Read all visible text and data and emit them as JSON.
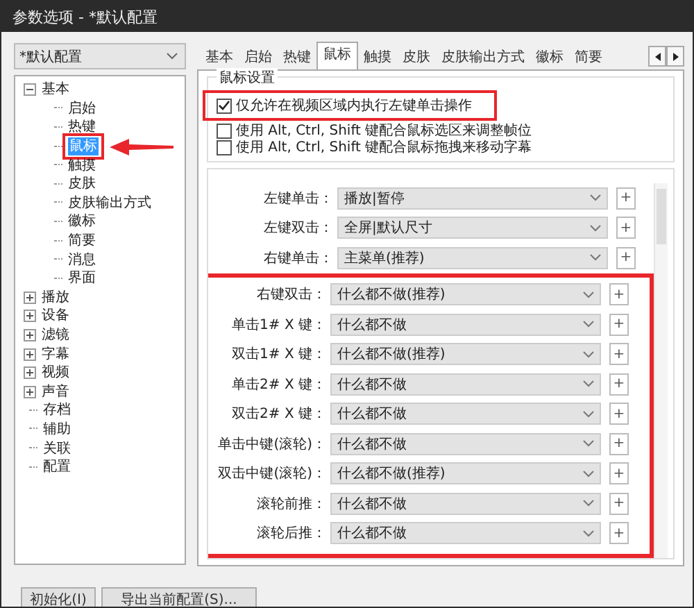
{
  "window": {
    "title": "参数选项 - *默认配置"
  },
  "profile_select": {
    "value": "*默认配置"
  },
  "tree": [
    {
      "label": "基本",
      "expanded": true,
      "selected": false,
      "children": [
        {
          "label": "启始",
          "selected": false
        },
        {
          "label": "热键",
          "selected": false
        },
        {
          "label": "鼠标",
          "selected": true
        },
        {
          "label": "触摸",
          "selected": false
        },
        {
          "label": "皮肤",
          "selected": false
        },
        {
          "label": "皮肤输出方式",
          "selected": false
        },
        {
          "label": "徽标",
          "selected": false
        },
        {
          "label": "简要",
          "selected": false
        },
        {
          "label": "消息",
          "selected": false
        },
        {
          "label": "界面",
          "selected": false
        }
      ]
    },
    {
      "label": "播放",
      "expanded": false,
      "selected": false
    },
    {
      "label": "设备",
      "expanded": false,
      "selected": false
    },
    {
      "label": "滤镜",
      "expanded": false,
      "selected": false
    },
    {
      "label": "字幕",
      "expanded": false,
      "selected": false
    },
    {
      "label": "视频",
      "expanded": false,
      "selected": false
    },
    {
      "label": "声音",
      "expanded": false,
      "selected": false
    },
    {
      "label": "存档",
      "selected": false
    },
    {
      "label": "辅助",
      "selected": false
    },
    {
      "label": "关联",
      "selected": false
    },
    {
      "label": "配置",
      "selected": false
    }
  ],
  "tabs": [
    {
      "label": "基本",
      "selected": false
    },
    {
      "label": "启始",
      "selected": false
    },
    {
      "label": "热键",
      "selected": false
    },
    {
      "label": "鼠标",
      "selected": true
    },
    {
      "label": "触摸",
      "selected": false
    },
    {
      "label": "皮肤",
      "selected": false
    },
    {
      "label": "皮肤输出方式",
      "selected": false
    },
    {
      "label": "徽标",
      "selected": false
    },
    {
      "label": "简要",
      "selected": false
    }
  ],
  "mouse_settings": {
    "title": "鼠标设置",
    "checkboxes": [
      {
        "label": "仅允许在视频区域内执行左键单击操作",
        "checked": true
      },
      {
        "label": "使用 Alt, Ctrl, Shift 键配合鼠标选区来调整帧位",
        "checked": false
      },
      {
        "label": "使用 Alt, Ctrl, Shift 键配合鼠标拖拽来移动字幕",
        "checked": false
      }
    ]
  },
  "bindings": [
    {
      "label": "左键单击：",
      "value": "播放|暂停",
      "add": "+"
    },
    {
      "label": "左键双击：",
      "value": "全屏|默认尺寸",
      "add": "+"
    },
    {
      "label": "右键单击：",
      "value": "主菜单(推荐)",
      "add": "+"
    },
    {
      "label": "右键双击：",
      "value": "什么都不做(推荐)",
      "add": "+"
    },
    {
      "label": "单击1# X 键：",
      "value": "什么都不做",
      "add": "+"
    },
    {
      "label": "双击1# X 键：",
      "value": "什么都不做(推荐)",
      "add": "+"
    },
    {
      "label": "单击2# X 键：",
      "value": "什么都不做",
      "add": "+"
    },
    {
      "label": "双击2# X 键：",
      "value": "什么都不做",
      "add": "+"
    },
    {
      "label": "单击中键(滚轮)：",
      "value": "什么都不做",
      "add": "+"
    },
    {
      "label": "双击中键(滚轮)：",
      "value": "什么都不做(推荐)",
      "add": "+"
    },
    {
      "label": "滚轮前推：",
      "value": "什么都不做",
      "add": "+"
    },
    {
      "label": "滚轮后推：",
      "value": "什么都不做",
      "add": "+"
    }
  ],
  "buttons": [
    "初始化(I)",
    "导出当前配置(S)..."
  ]
}
